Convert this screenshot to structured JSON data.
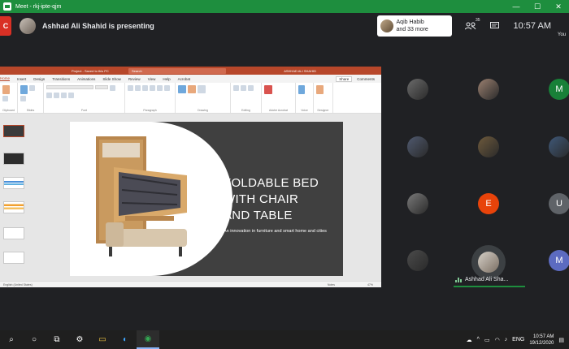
{
  "window": {
    "title": "Meet - rkj-ipte-qjm",
    "minimize": "—",
    "maximize": "☐",
    "close": "✕"
  },
  "meet": {
    "red_tag": "C",
    "presenting_text": "Ashhad Ali Shahid is presenting",
    "joined": {
      "line1": "Aqib Habib",
      "line2": "and 33 more"
    },
    "people_count": "35",
    "time": "10:57 AM",
    "you_label": "You"
  },
  "ppt": {
    "title": "Project - Saved to this PC",
    "search": "Search",
    "user": "ASHHAD ALI SHAHID",
    "tabs": [
      "Home",
      "Insert",
      "Design",
      "Transitions",
      "Animations",
      "Slide Show",
      "Review",
      "View",
      "Help",
      "Acrobat"
    ],
    "share": "Share",
    "comments": "Comments",
    "groups": [
      "Clipboard",
      "Slides",
      "Font",
      "Paragraph",
      "Drawing",
      "Editing",
      "Adobe Acrobat",
      "Voice",
      "Designer"
    ],
    "slide": {
      "headline_1": "FOLDABLE BED",
      "headline_2": "WITH CHAIR",
      "headline_3": "AND TABLE",
      "subline": "An innovation in furniture and smart home and cities"
    },
    "status_left": "English (United States)",
    "status_notes": "Notes",
    "zoom": "47%"
  },
  "participants": [
    {
      "initial": "",
      "color": "#6b6b6b"
    },
    {
      "initial": "",
      "color": "#9b8070"
    },
    {
      "initial": "M",
      "color": "#188038"
    },
    {
      "initial": "",
      "color": "#505a70"
    },
    {
      "initial": "",
      "color": "#6e5a3c"
    },
    {
      "initial": "",
      "color": "#3f5878"
    },
    {
      "initial": "",
      "color": "#7a7a7a"
    },
    {
      "initial": "E",
      "color": "#e8430a"
    },
    {
      "initial": "U",
      "color": "#5f6368"
    },
    {
      "initial": "",
      "color": "#4b4b4b"
    },
    {
      "initial": "M",
      "color": "#5c6bc0"
    }
  ],
  "presenter_tile": {
    "name": "Ashhad Ali Sha..."
  },
  "taskbar": {
    "search_icon": "⌕",
    "cortana_icon": "○",
    "taskview_icon": "⧉",
    "settings_icon": "⚙",
    "explorer_icon": "▭",
    "edge_icon": "◐",
    "chrome_icon": "◉",
    "lang": "ENG",
    "time": "10:57 AM",
    "date": "19/12/2020"
  }
}
